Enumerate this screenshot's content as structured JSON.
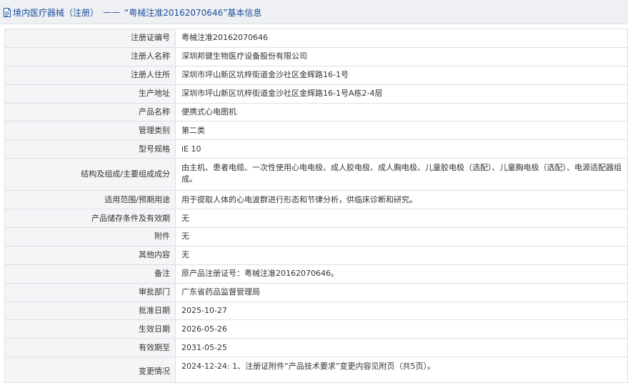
{
  "header": {
    "icon": "document-icon",
    "prefix": "境内医疗器械（注册）",
    "separator": "——",
    "title": "“粤械注准20162070646”基本信息"
  },
  "colors": {
    "header_text": "#1c4e9c",
    "header_bg": "#eef0f3",
    "label_bg": "#f4f5f7",
    "border": "#dcdfe4"
  },
  "fields": [
    {
      "label": "注册证编号",
      "value": "粤械注准20162070646"
    },
    {
      "label": "注册人名称",
      "value": "深圳邦健生物医疗设备股份有限公司"
    },
    {
      "label": "注册人住所",
      "value": "深圳市坪山新区坑梓街道金沙社区金辉路16-1号"
    },
    {
      "label": "生产地址",
      "value": "深圳市坪山新区坑梓街道金沙社区金辉路16-1号A栋2-4层"
    },
    {
      "label": "产品名称",
      "value": "便携式心电图机"
    },
    {
      "label": "管理类别",
      "value": "第二类"
    },
    {
      "label": "型号规格",
      "value": "iE 10"
    },
    {
      "label": "结构及组成/主要组成成分",
      "value": "由主机、患者电缆、一次性使用心电电极、成人胶电极、成人胸电极、儿童胶电极（选配）、儿童胸电极（选配）、电源适配器组成。"
    },
    {
      "label": "适用范围/预期用途",
      "value": "用于提取人体的心电波群进行形态和节律分析，供临床诊断和研究。"
    },
    {
      "label": "产品储存条件及有效期",
      "value": "无"
    },
    {
      "label": "附件",
      "value": "无"
    },
    {
      "label": "其他内容",
      "value": "无"
    },
    {
      "label": "备注",
      "value": "原产品注册证号：粤械注准20162070646。"
    },
    {
      "label": "审批部门",
      "value": "广东省药品监督管理局"
    },
    {
      "label": "批准日期",
      "value": "2025-10-27"
    },
    {
      "label": "生效日期",
      "value": "2026-05-26"
    },
    {
      "label": "有效期至",
      "value": "2031-05-25"
    },
    {
      "label": "变更情况",
      "value": "2024-12-24: 1、注册证附件“产品技术要求”变更内容见附页（共5页）。"
    }
  ]
}
